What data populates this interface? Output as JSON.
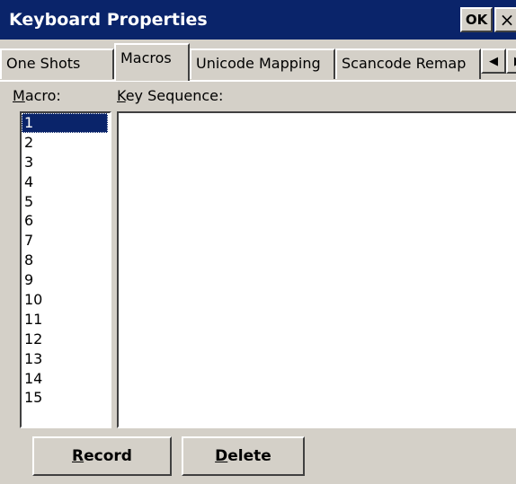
{
  "window": {
    "title": "Keyboard Properties",
    "ok_label": "OK",
    "close_glyph": "×"
  },
  "tabs": [
    {
      "label": "One Shots",
      "active": false
    },
    {
      "label": "Macros",
      "active": true
    },
    {
      "label": "Unicode Mapping",
      "active": false
    },
    {
      "label": "Scancode Remap",
      "active": false
    }
  ],
  "tab_scroll": {
    "left_glyph": "◀",
    "right_glyph": "▶"
  },
  "labels": {
    "macro_accel": "M",
    "macro_rest": "acro:",
    "keyseq_accel": "K",
    "keyseq_rest": "ey Sequence:"
  },
  "macro_list": {
    "items": [
      "1",
      "2",
      "3",
      "4",
      "5",
      "6",
      "7",
      "8",
      "9",
      "10",
      "11",
      "12",
      "13",
      "14",
      "15"
    ],
    "selected": "1"
  },
  "key_sequence": {
    "value": ""
  },
  "buttons": {
    "record_accel": "R",
    "record_rest": "ecord",
    "delete_accel": "D",
    "delete_rest": "elete"
  }
}
